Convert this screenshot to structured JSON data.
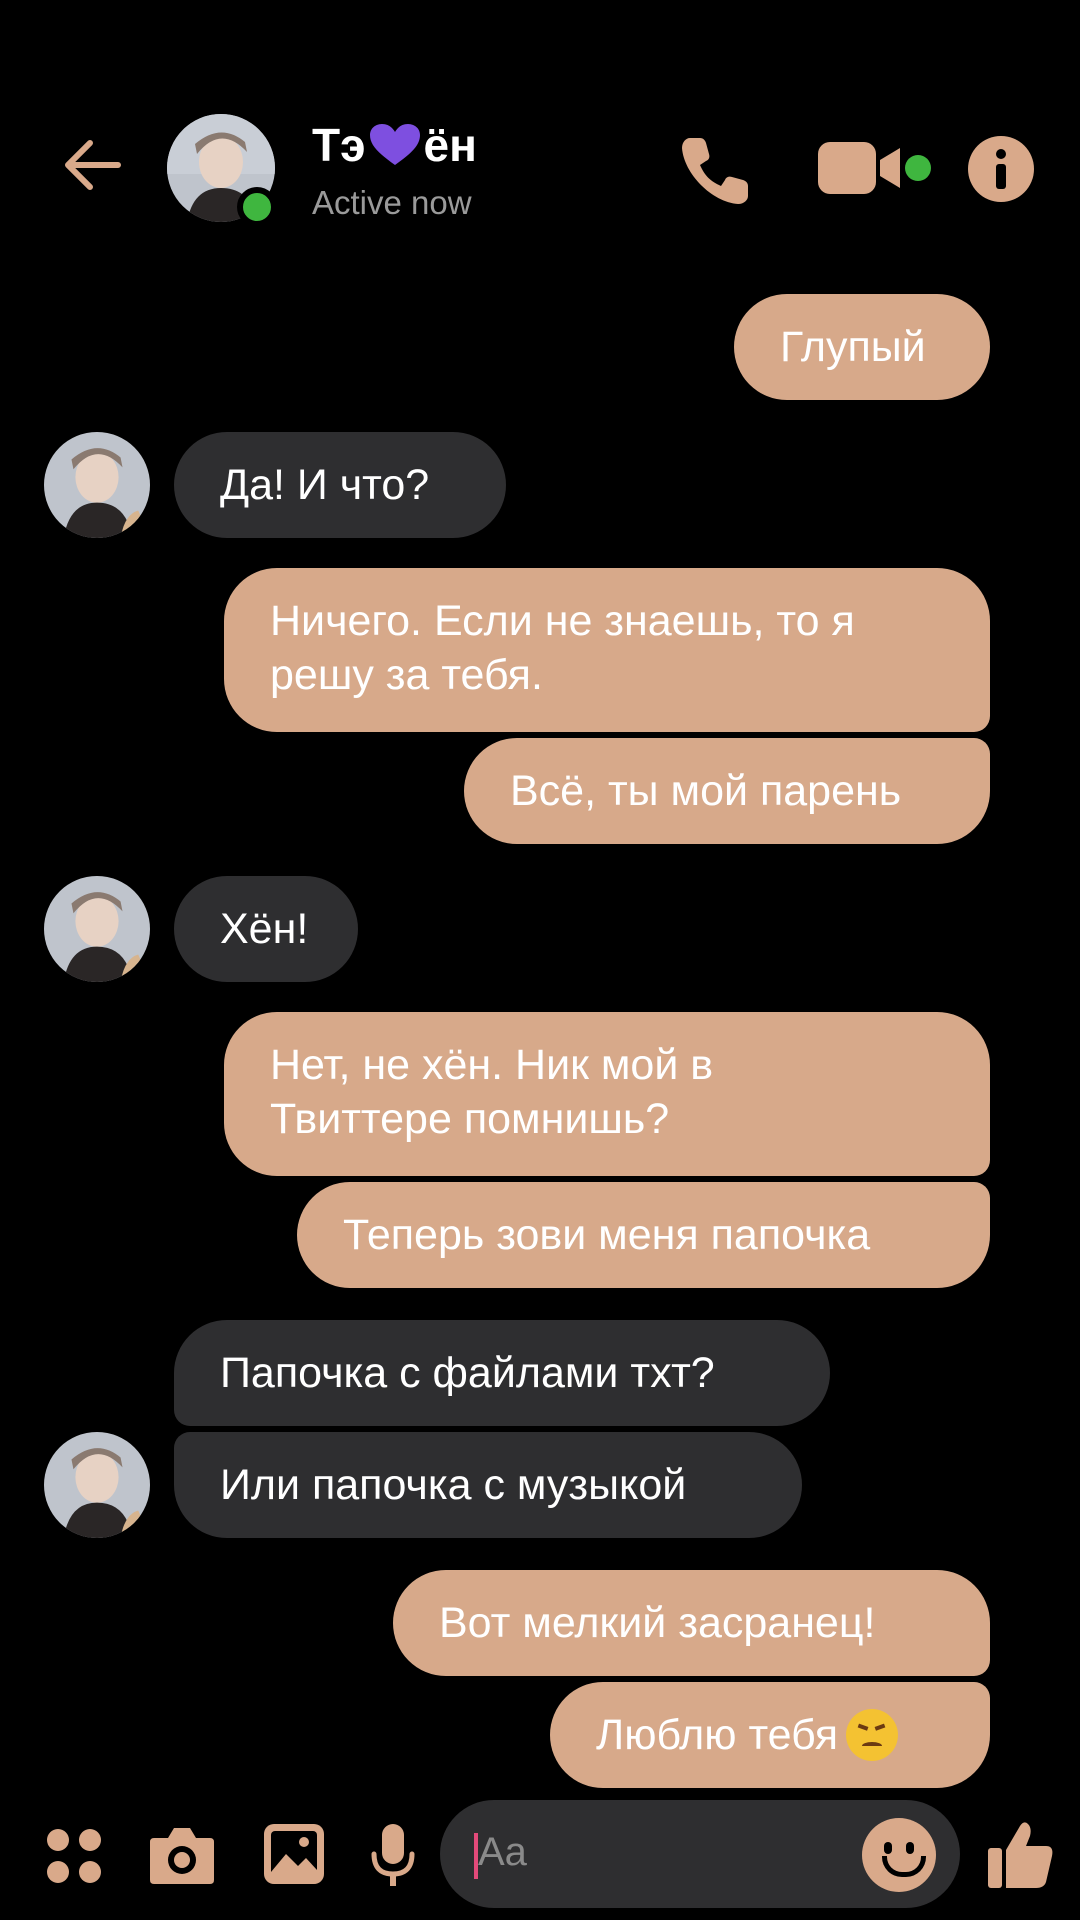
{
  "header": {
    "name_part1": "Тэ",
    "name_part2": "ён",
    "status": "Active now"
  },
  "colors": {
    "accent": "#d7a98a",
    "incoming_bubble": "#2e2e30",
    "online": "#3fb63f",
    "heart": "#7e4fe0"
  },
  "messages": [
    {
      "dir": "out",
      "text": "Глупый"
    },
    {
      "dir": "in",
      "text": "Да! И что?"
    },
    {
      "dir": "out",
      "text": "Ничего. Если не знаешь, то я решу за тебя."
    },
    {
      "dir": "out",
      "text": "Всё, ты мой парень"
    },
    {
      "dir": "in",
      "text": "Хён!"
    },
    {
      "dir": "out",
      "text": "Нет, не хён. Ник мой в Твиттере помнишь?"
    },
    {
      "dir": "out",
      "text": "Теперь зови меня папочка"
    },
    {
      "dir": "in",
      "text": "Папочка с файлами тхт?"
    },
    {
      "dir": "in",
      "text": "Или папочка с музыкой"
    },
    {
      "dir": "out",
      "text": "Вот мелкий засранец!"
    },
    {
      "dir": "out",
      "text": "Люблю тебя",
      "emoji": "confounded-face"
    }
  ],
  "composer": {
    "placeholder": "Aa"
  },
  "icons": {
    "back": "arrow-left-icon",
    "call": "phone-icon",
    "video": "video-camera-icon",
    "info": "info-icon",
    "menu": "four-dots-icon",
    "camera": "camera-icon",
    "gallery": "image-icon",
    "mic": "microphone-icon",
    "emoji": "smiley-icon",
    "like": "thumbs-up-icon"
  }
}
